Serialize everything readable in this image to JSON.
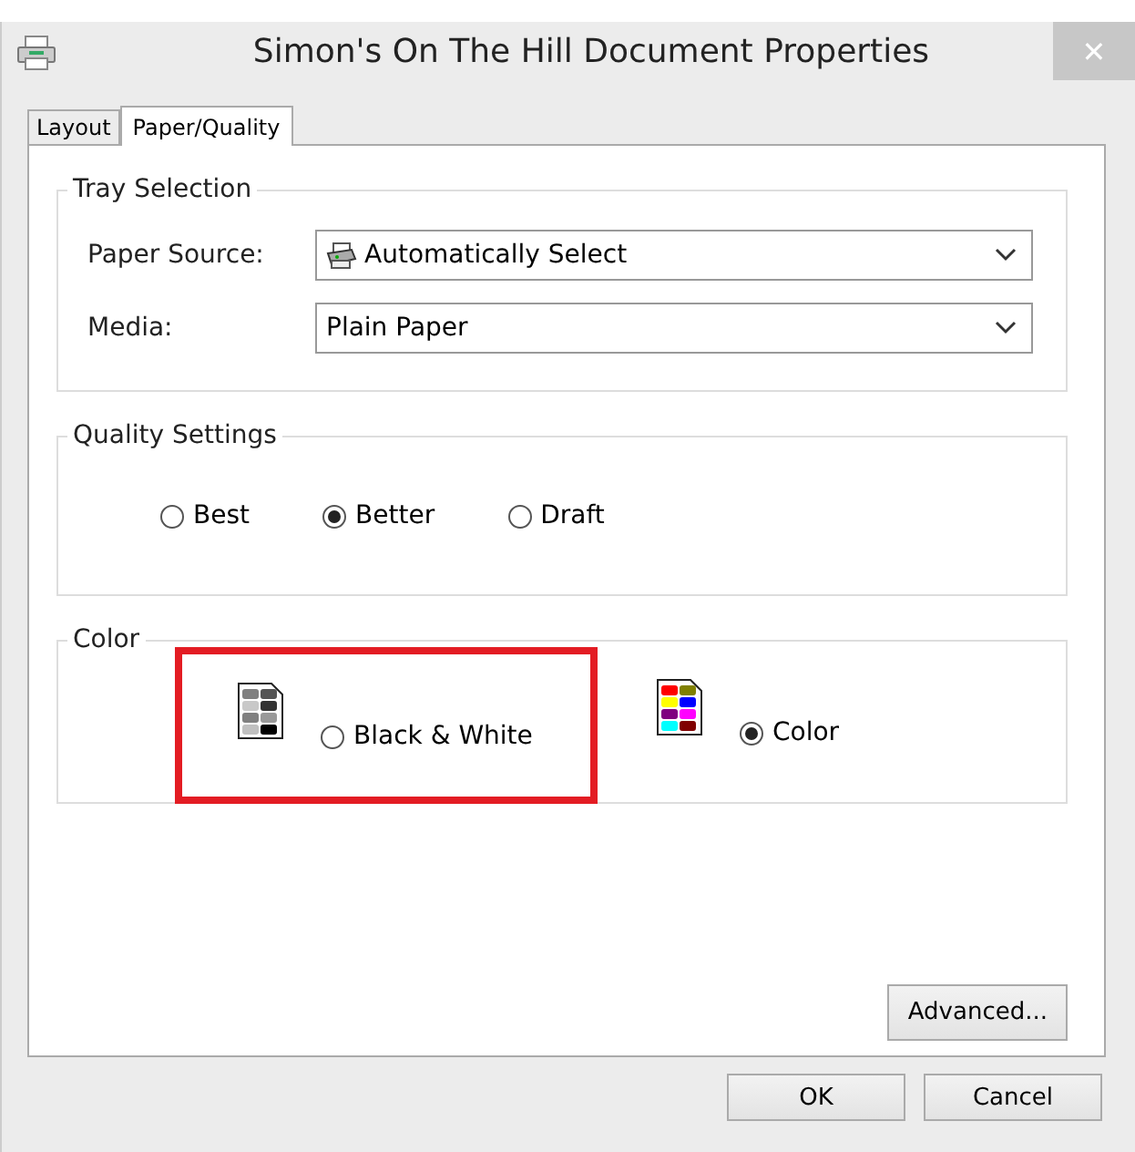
{
  "window": {
    "title": "Simon's On The Hill Document Properties",
    "close": "✕"
  },
  "tabs": [
    {
      "label": "Layout",
      "selected": false
    },
    {
      "label": "Paper/Quality",
      "selected": true
    }
  ],
  "tray_selection": {
    "title": "Tray Selection",
    "fields": [
      {
        "label": "Paper Source:",
        "value": "Automatically Select",
        "kind": "printer"
      },
      {
        "label": "Media:",
        "value": "Plain Paper",
        "kind": "plain"
      }
    ]
  },
  "quality_settings": {
    "title": "Quality Settings",
    "options": [
      {
        "label": "Best",
        "selected": false
      },
      {
        "label": "Better",
        "selected": true
      },
      {
        "label": "Draft",
        "selected": false
      }
    ]
  },
  "color": {
    "title": "Color",
    "options": [
      {
        "label": "Black & White",
        "selected": false,
        "kind": "mono",
        "highlighted": true
      },
      {
        "label": "Color",
        "selected": true,
        "kind": "color",
        "highlighted": false
      }
    ]
  },
  "advanced_button": "Advanced...",
  "buttons": [
    "OK",
    "Cancel"
  ]
}
